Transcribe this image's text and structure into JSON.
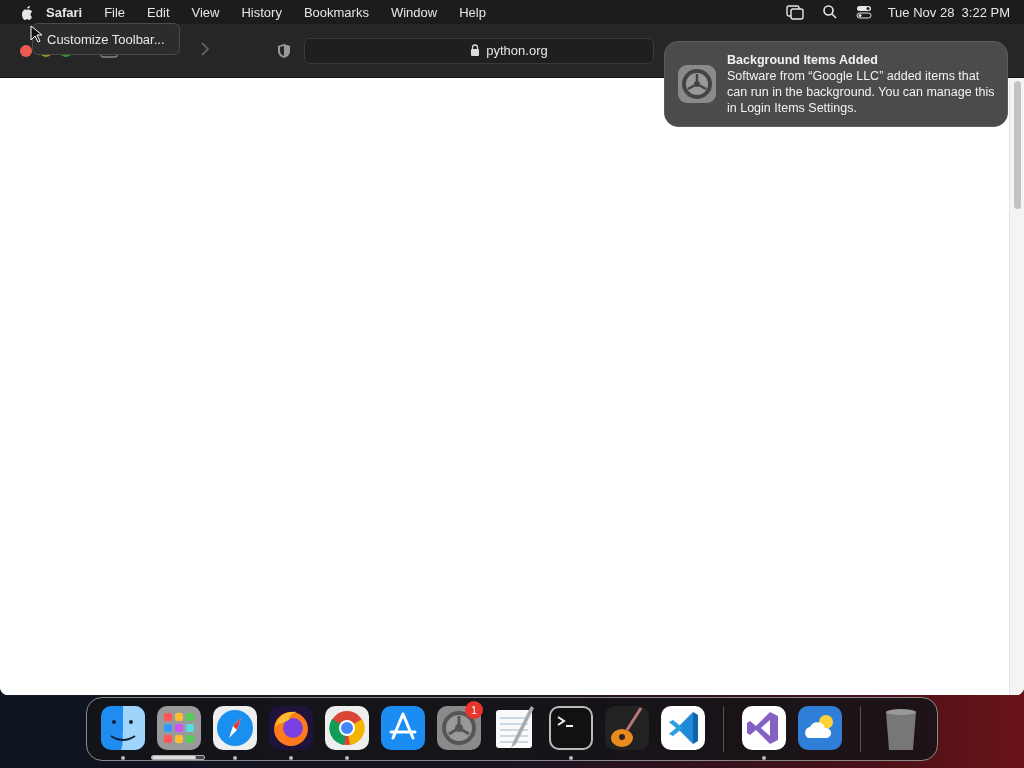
{
  "menu_bar": {
    "app_name": "Safari",
    "menus": [
      "File",
      "Edit",
      "View",
      "History",
      "Bookmarks",
      "Window",
      "Help"
    ],
    "clock": "Tue Nov 28  3:22 PM"
  },
  "tooltip": {
    "text": "Customize Toolbar..."
  },
  "toolbar": {
    "address": "python.org",
    "secure": true,
    "forward_enabled": false
  },
  "notification": {
    "title": "Background Items Added",
    "body": "Software from “Google LLC” added items that can run in the background. You can manage this in Login Items Settings."
  },
  "dock": {
    "sections": [
      {
        "apps": [
          {
            "kind": "finder",
            "running": true
          },
          {
            "kind": "launchpad",
            "running": false,
            "level": 0.85
          },
          {
            "kind": "safari",
            "running": true
          },
          {
            "kind": "firefox",
            "running": true
          },
          {
            "kind": "chrome",
            "running": true
          },
          {
            "kind": "appstore",
            "running": false
          },
          {
            "kind": "settings",
            "running": false,
            "badge": "1"
          },
          {
            "kind": "textedit",
            "running": false
          },
          {
            "kind": "terminal",
            "running": true
          },
          {
            "kind": "garageband",
            "running": false
          },
          {
            "kind": "vscode",
            "running": false
          }
        ]
      },
      {
        "apps": [
          {
            "kind": "visualstudio",
            "running": true
          },
          {
            "kind": "weather",
            "running": false
          }
        ]
      },
      {
        "apps": [
          {
            "kind": "trash",
            "running": false
          }
        ]
      }
    ]
  }
}
